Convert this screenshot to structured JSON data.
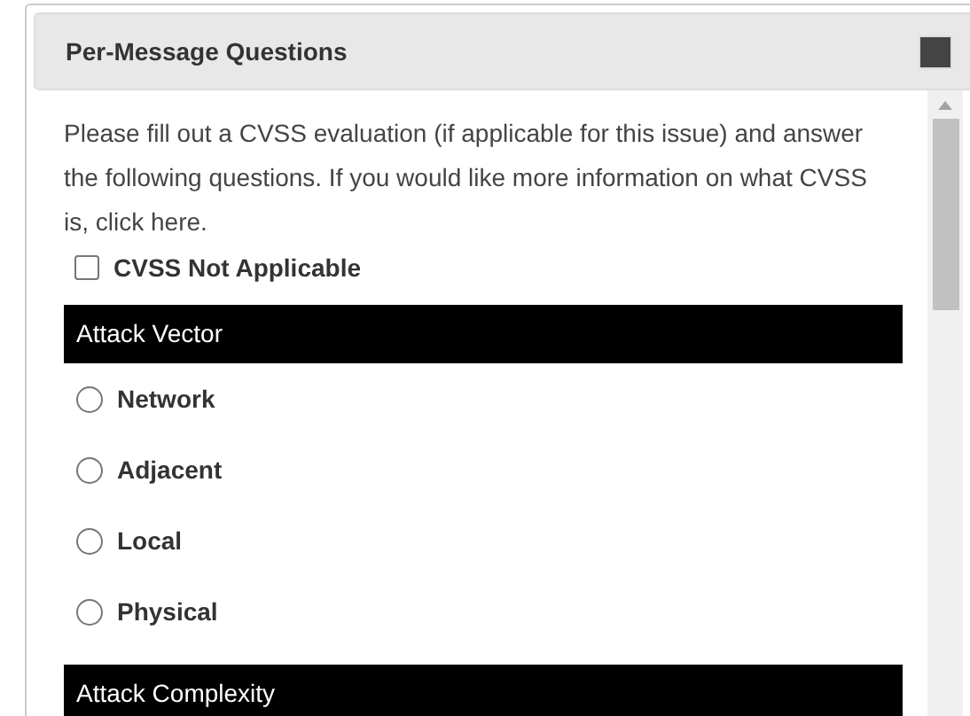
{
  "panel": {
    "title": "Per-Message Questions"
  },
  "intro": "Please fill out a CVSS evaluation (if applicable for this issue) and answer the following questions. If you would like more information on what CVSS is, click here.",
  "not_applicable": {
    "label": "CVSS Not Applicable",
    "checked": false
  },
  "sections": [
    {
      "title": "Attack Vector",
      "options": [
        {
          "label": "Network",
          "selected": false
        },
        {
          "label": "Adjacent",
          "selected": false
        },
        {
          "label": "Local",
          "selected": false
        },
        {
          "label": "Physical",
          "selected": false
        }
      ]
    },
    {
      "title": "Attack Complexity"
    }
  ]
}
